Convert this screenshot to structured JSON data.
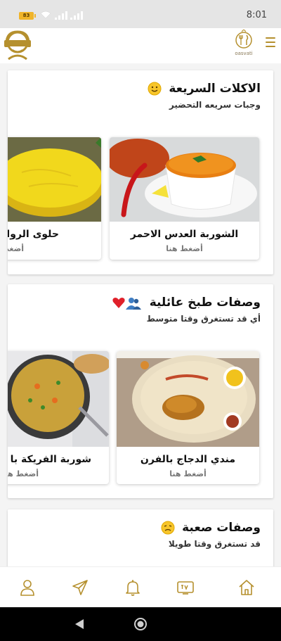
{
  "status_bar": {
    "battery": "83",
    "time": "8:01"
  },
  "header": {
    "logo_icon": "chef-avatar-icon",
    "brand_name": "oasvati",
    "menu_icon": "hamburger-menu-icon"
  },
  "sections": [
    {
      "title": "الاكلات السريعة",
      "emoji": "smile-emoji",
      "subtitle": "وجبات سريعه التحضير",
      "cards": [
        {
          "name": "الشوربة العدس الاحمر",
          "cta": "أضغط هنا"
        },
        {
          "name": "حلوى الرواني",
          "cta": "أضغط هنا"
        }
      ]
    },
    {
      "title": "وصفات طبخ عائلية",
      "emoji": "family-heart-emoji",
      "subtitle": "أي قد تستغرق وقتا متوسط",
      "cards": [
        {
          "name": "مندي الدجاج بالفرن",
          "cta": "أضغط هنا"
        },
        {
          "name": "شوربة الفريكة با",
          "cta": "أضغط هنا"
        }
      ]
    },
    {
      "title": "وصفات صعبة",
      "emoji": "tired-face-emoji",
      "subtitle": "قد تستغرق وقتا طويلا"
    }
  ],
  "bottom_nav": [
    "profile-icon",
    "send-icon",
    "bell-icon",
    "tv-icon",
    "home-icon"
  ],
  "colors": {
    "accent_gold": "#b5902e",
    "background": "#f4f4f4"
  }
}
